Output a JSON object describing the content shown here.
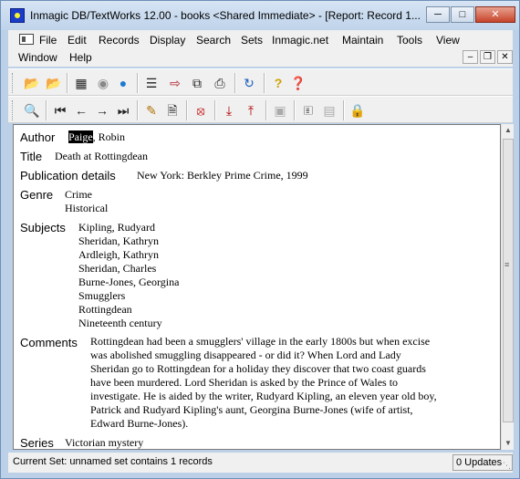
{
  "window": {
    "title": "Inmagic DB/TextWorks 12.00  - books <Shared Immediate> - [Report: Record 1...",
    "min_icon": "minimize-icon",
    "max_icon": "maximize-icon",
    "close_icon": "close-icon"
  },
  "menu": {
    "items": [
      "File",
      "Edit",
      "Records",
      "Display",
      "Search",
      "Sets",
      "Inmagic.net",
      "Maintain",
      "Tools",
      "View"
    ],
    "row2": [
      "Window",
      "Help"
    ]
  },
  "toolbar1": {
    "icons": [
      "open-folder-icon",
      "open-folder-alt-icon",
      "form-icon",
      "eye-icon",
      "globe-icon",
      "list-icon",
      "split-icon",
      "copy-icon",
      "print-icon",
      "refresh-icon",
      "help-icon",
      "context-help-icon"
    ]
  },
  "toolbar2": {
    "icons": [
      "find-icon",
      "first-record-icon",
      "prev-record-icon",
      "next-record-icon",
      "last-record-icon",
      "edit-record-icon",
      "new-record-icon",
      "delete-record-icon",
      "import-icon",
      "export-icon",
      "grayed-icon",
      "save-set-icon",
      "grayed-icon-2",
      "lock-icon"
    ]
  },
  "record": {
    "author_label": "Author",
    "author_highlight": "Paige",
    "author_rest": ", Robin",
    "title_label": "Title",
    "title_value": "Death at Rottingdean",
    "pub_label": "Publication details",
    "pub_value": "New York: Berkley Prime Crime, 1999",
    "genre_label": "Genre",
    "genres": [
      "Crime",
      "Historical"
    ],
    "subjects_label": "Subjects",
    "subjects": [
      "Kipling, Rudyard",
      "Sheridan, Kathryn",
      "Ardleigh, Kathryn",
      "Sheridan, Charles",
      "Burne-Jones, Georgina",
      "Smugglers",
      "Rottingdean",
      "Nineteenth century"
    ],
    "comments_label": "Comments",
    "comments_value": "Rottingdean had been a smugglers' village in the early 1800s but when excise was abolished smuggling disappeared - or did it? When Lord and Lady Sheridan go to Rottingdean for a holiday they discover that two coast guards have been murdered. Lord Sheridan is asked by the Prince of Wales to investigate. He is aided by the writer, Rudyard Kipling, an eleven year old boy, Patrick and Rudyard Kipling's aunt, Georgina Burne-Jones (wife of artist, Edward Burne-Jones).",
    "series_label": "Series",
    "series_value": "Victorian mystery"
  },
  "status": {
    "left": "Current Set: unnamed set contains 1 records",
    "right": "0 Updates"
  }
}
